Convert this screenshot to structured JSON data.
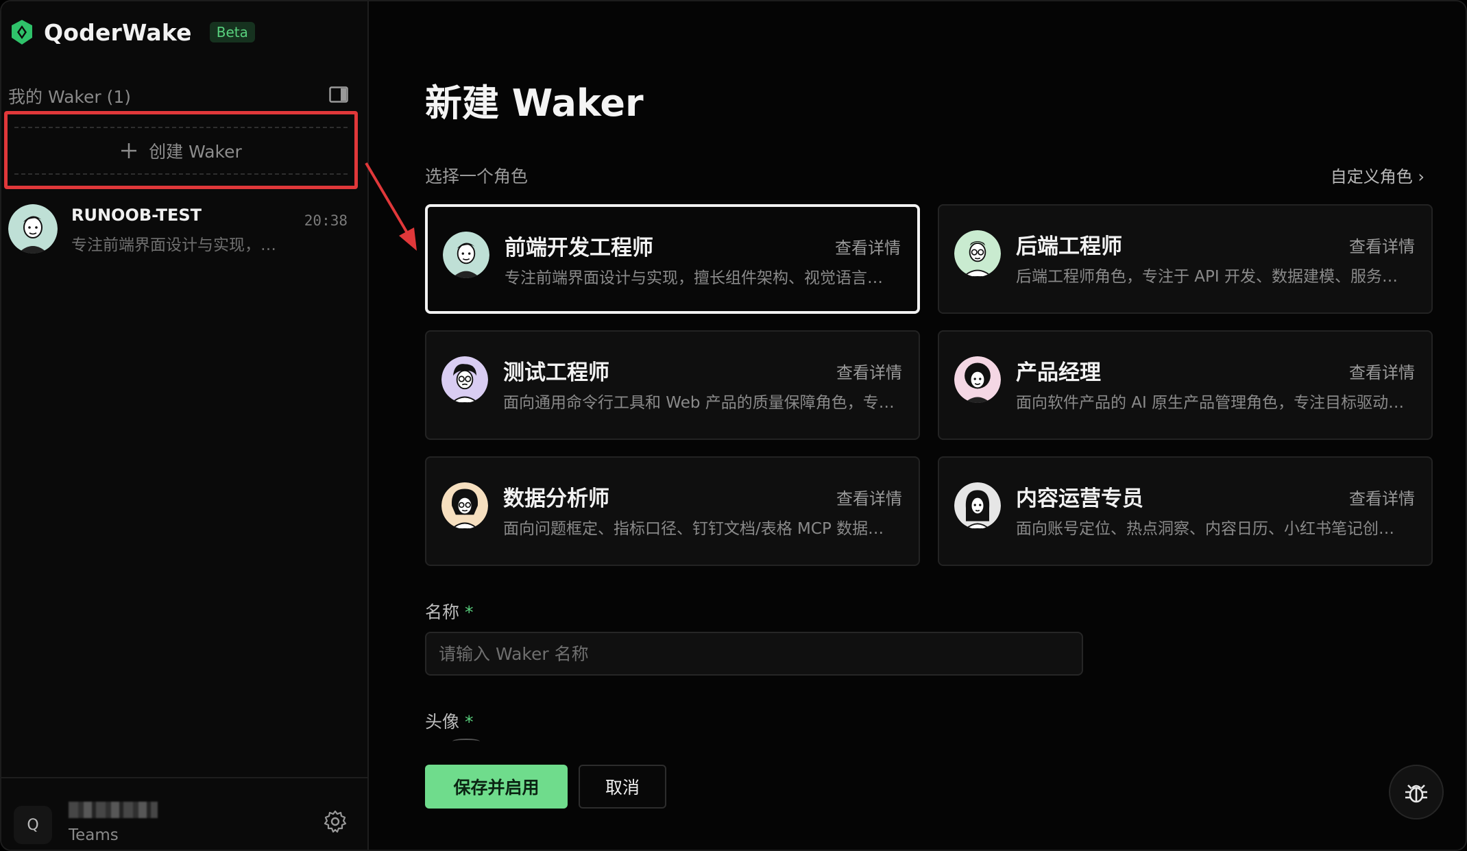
{
  "brand": {
    "name": "QoderWake",
    "badge": "Beta"
  },
  "sidebar": {
    "section_title": "我的 Waker (1)",
    "create_label": "创建 Waker",
    "wakers": [
      {
        "name": "RUNOOB-TEST",
        "time": "20:38",
        "desc": "专注前端界面设计与实现，…"
      }
    ],
    "footer": {
      "avatar_letter": "Q",
      "team_label": "Teams"
    }
  },
  "main": {
    "title": "新建 Waker",
    "role_section": "选择一个角色",
    "custom_role": "自定义角色 ›",
    "roles": [
      {
        "title": "前端开发工程师",
        "link": "查看详情",
        "desc": "专注前端界面设计与实现，擅长组件架构、视觉语言…",
        "selected": true
      },
      {
        "title": "后端工程师",
        "link": "查看详情",
        "desc": "后端工程师角色，专注于 API 开发、数据建模、服务…"
      },
      {
        "title": "测试工程师",
        "link": "查看详情",
        "desc": "面向通用命令行工具和 Web 产品的质量保障角色，专…"
      },
      {
        "title": "产品经理",
        "link": "查看详情",
        "desc": "面向软件产品的 AI 原生产品管理角色，专注目标驱动…"
      },
      {
        "title": "数据分析师",
        "link": "查看详情",
        "desc": "面向问题框定、指标口径、钉钉文档/表格 MCP 数据…"
      },
      {
        "title": "内容运营专员",
        "link": "查看详情",
        "desc": "面向账号定位、热点洞察、内容日历、小红书笔记创…"
      }
    ],
    "name_field": {
      "label": "名称",
      "required": "*",
      "placeholder": "请输入 Waker 名称",
      "value": ""
    },
    "avatar_field": {
      "label": "头像",
      "required": "*"
    },
    "buttons": {
      "save": "保存并启用",
      "cancel": "取消"
    }
  },
  "colors": {
    "accent": "#6fdc8c",
    "highlight_box": "#e0383a",
    "background": "#050505"
  },
  "icons": [
    "qoder-logo-icon",
    "sidebar-panel-icon",
    "plus-icon",
    "settings-gear-icon",
    "bug-icon",
    "annotation-arrow"
  ]
}
